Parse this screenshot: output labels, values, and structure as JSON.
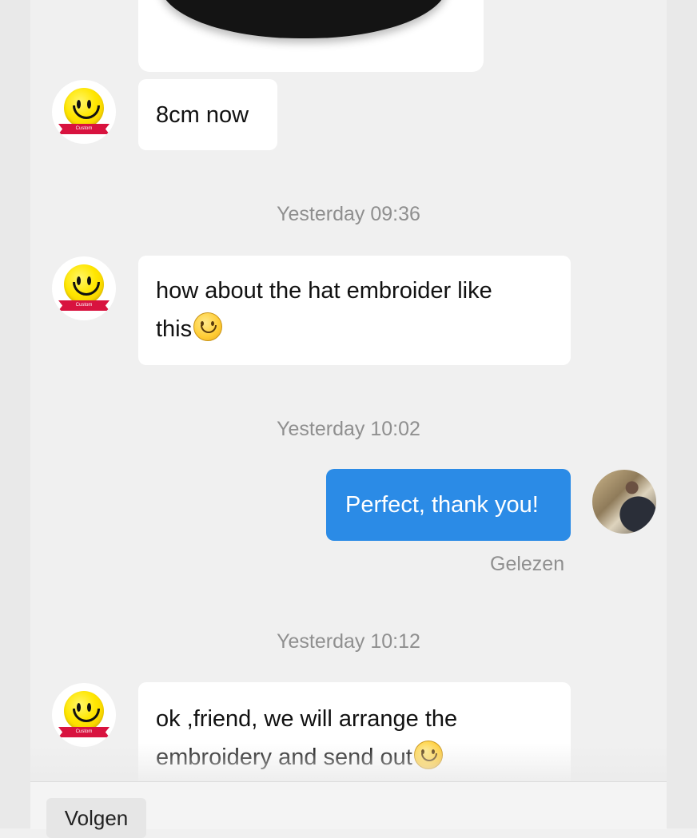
{
  "messages": [
    {
      "text": "8cm now"
    },
    {
      "timestamp": "Yesterday 09:36",
      "text": "how about the hat embroider like",
      "text2": "this"
    },
    {
      "timestamp": "Yesterday 10:02",
      "text": "Perfect, thank you!",
      "status": "Gelezen"
    },
    {
      "timestamp": "Yesterday 10:12",
      "text": "ok ,friend, we will arrange the",
      "text2": "embroidery and send out"
    }
  ],
  "avatar_ribbon": "Custom",
  "bottom_bar": {
    "follow_label": "Volgen"
  },
  "icons": {
    "contact_avatar": "smiley-face-icon",
    "inline_emoji": "smile-emoji-icon",
    "user_avatar": "user-photo-avatar"
  },
  "colors": {
    "outgoing_bubble": "#2b8be6",
    "background": "#f0f0f0",
    "timestamp": "#8f8f8f"
  }
}
